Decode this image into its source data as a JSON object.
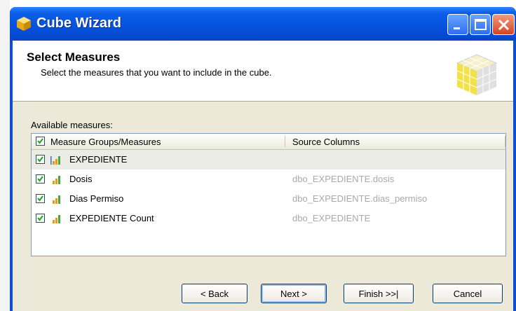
{
  "window": {
    "title": "Cube Wizard"
  },
  "header": {
    "title": "Select Measures",
    "subtitle": "Select the measures that you want to include in the cube."
  },
  "measures": {
    "label": "Available measures:",
    "columns": [
      "Measure Groups/Measures",
      "Source Columns"
    ],
    "rows": [
      {
        "name": "EXPEDIENTE",
        "source": "",
        "checked": true,
        "type": "group"
      },
      {
        "name": "Dosis",
        "source": "dbo_EXPEDIENTE.dosis",
        "checked": true,
        "type": "measure"
      },
      {
        "name": "Dias Permiso",
        "source": "dbo_EXPEDIENTE.dias_permiso",
        "checked": true,
        "type": "measure"
      },
      {
        "name": "EXPEDIENTE Count",
        "source": "dbo_EXPEDIENTE",
        "checked": true,
        "type": "measure"
      }
    ]
  },
  "buttons": {
    "back": "< Back",
    "next": "Next >",
    "finish": "Finish >>|",
    "cancel": "Cancel"
  },
  "colors": {
    "titlebar": "#0652df",
    "dialog_bg": "#ece9d8",
    "source_text": "#a9a9a9"
  }
}
